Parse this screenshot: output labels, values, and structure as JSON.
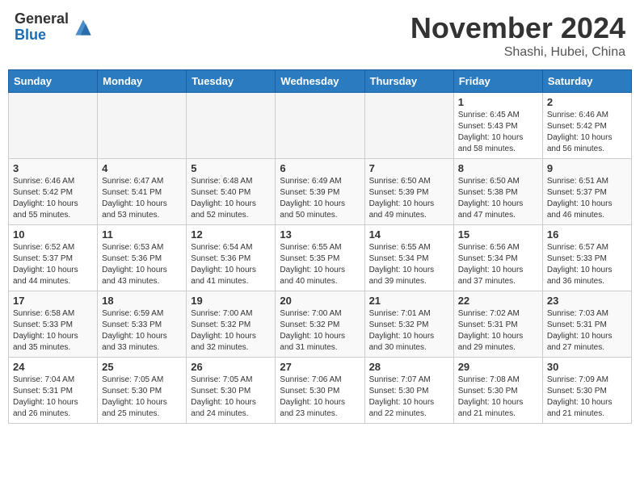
{
  "header": {
    "logo_general": "General",
    "logo_blue": "Blue",
    "month_title": "November 2024",
    "location": "Shashi, Hubei, China"
  },
  "days_of_week": [
    "Sunday",
    "Monday",
    "Tuesday",
    "Wednesday",
    "Thursday",
    "Friday",
    "Saturday"
  ],
  "weeks": [
    [
      {
        "day": "",
        "empty": true
      },
      {
        "day": "",
        "empty": true
      },
      {
        "day": "",
        "empty": true
      },
      {
        "day": "",
        "empty": true
      },
      {
        "day": "",
        "empty": true
      },
      {
        "day": "1",
        "sunrise": "6:45 AM",
        "sunset": "5:43 PM",
        "daylight": "10 hours and 58 minutes."
      },
      {
        "day": "2",
        "sunrise": "6:46 AM",
        "sunset": "5:42 PM",
        "daylight": "10 hours and 56 minutes."
      }
    ],
    [
      {
        "day": "3",
        "sunrise": "6:46 AM",
        "sunset": "5:42 PM",
        "daylight": "10 hours and 55 minutes."
      },
      {
        "day": "4",
        "sunrise": "6:47 AM",
        "sunset": "5:41 PM",
        "daylight": "10 hours and 53 minutes."
      },
      {
        "day": "5",
        "sunrise": "6:48 AM",
        "sunset": "5:40 PM",
        "daylight": "10 hours and 52 minutes."
      },
      {
        "day": "6",
        "sunrise": "6:49 AM",
        "sunset": "5:39 PM",
        "daylight": "10 hours and 50 minutes."
      },
      {
        "day": "7",
        "sunrise": "6:50 AM",
        "sunset": "5:39 PM",
        "daylight": "10 hours and 49 minutes."
      },
      {
        "day": "8",
        "sunrise": "6:50 AM",
        "sunset": "5:38 PM",
        "daylight": "10 hours and 47 minutes."
      },
      {
        "day": "9",
        "sunrise": "6:51 AM",
        "sunset": "5:37 PM",
        "daylight": "10 hours and 46 minutes."
      }
    ],
    [
      {
        "day": "10",
        "sunrise": "6:52 AM",
        "sunset": "5:37 PM",
        "daylight": "10 hours and 44 minutes."
      },
      {
        "day": "11",
        "sunrise": "6:53 AM",
        "sunset": "5:36 PM",
        "daylight": "10 hours and 43 minutes."
      },
      {
        "day": "12",
        "sunrise": "6:54 AM",
        "sunset": "5:36 PM",
        "daylight": "10 hours and 41 minutes."
      },
      {
        "day": "13",
        "sunrise": "6:55 AM",
        "sunset": "5:35 PM",
        "daylight": "10 hours and 40 minutes."
      },
      {
        "day": "14",
        "sunrise": "6:55 AM",
        "sunset": "5:34 PM",
        "daylight": "10 hours and 39 minutes."
      },
      {
        "day": "15",
        "sunrise": "6:56 AM",
        "sunset": "5:34 PM",
        "daylight": "10 hours and 37 minutes."
      },
      {
        "day": "16",
        "sunrise": "6:57 AM",
        "sunset": "5:33 PM",
        "daylight": "10 hours and 36 minutes."
      }
    ],
    [
      {
        "day": "17",
        "sunrise": "6:58 AM",
        "sunset": "5:33 PM",
        "daylight": "10 hours and 35 minutes."
      },
      {
        "day": "18",
        "sunrise": "6:59 AM",
        "sunset": "5:33 PM",
        "daylight": "10 hours and 33 minutes."
      },
      {
        "day": "19",
        "sunrise": "7:00 AM",
        "sunset": "5:32 PM",
        "daylight": "10 hours and 32 minutes."
      },
      {
        "day": "20",
        "sunrise": "7:00 AM",
        "sunset": "5:32 PM",
        "daylight": "10 hours and 31 minutes."
      },
      {
        "day": "21",
        "sunrise": "7:01 AM",
        "sunset": "5:32 PM",
        "daylight": "10 hours and 30 minutes."
      },
      {
        "day": "22",
        "sunrise": "7:02 AM",
        "sunset": "5:31 PM",
        "daylight": "10 hours and 29 minutes."
      },
      {
        "day": "23",
        "sunrise": "7:03 AM",
        "sunset": "5:31 PM",
        "daylight": "10 hours and 27 minutes."
      }
    ],
    [
      {
        "day": "24",
        "sunrise": "7:04 AM",
        "sunset": "5:31 PM",
        "daylight": "10 hours and 26 minutes."
      },
      {
        "day": "25",
        "sunrise": "7:05 AM",
        "sunset": "5:30 PM",
        "daylight": "10 hours and 25 minutes."
      },
      {
        "day": "26",
        "sunrise": "7:05 AM",
        "sunset": "5:30 PM",
        "daylight": "10 hours and 24 minutes."
      },
      {
        "day": "27",
        "sunrise": "7:06 AM",
        "sunset": "5:30 PM",
        "daylight": "10 hours and 23 minutes."
      },
      {
        "day": "28",
        "sunrise": "7:07 AM",
        "sunset": "5:30 PM",
        "daylight": "10 hours and 22 minutes."
      },
      {
        "day": "29",
        "sunrise": "7:08 AM",
        "sunset": "5:30 PM",
        "daylight": "10 hours and 21 minutes."
      },
      {
        "day": "30",
        "sunrise": "7:09 AM",
        "sunset": "5:30 PM",
        "daylight": "10 hours and 21 minutes."
      }
    ]
  ]
}
